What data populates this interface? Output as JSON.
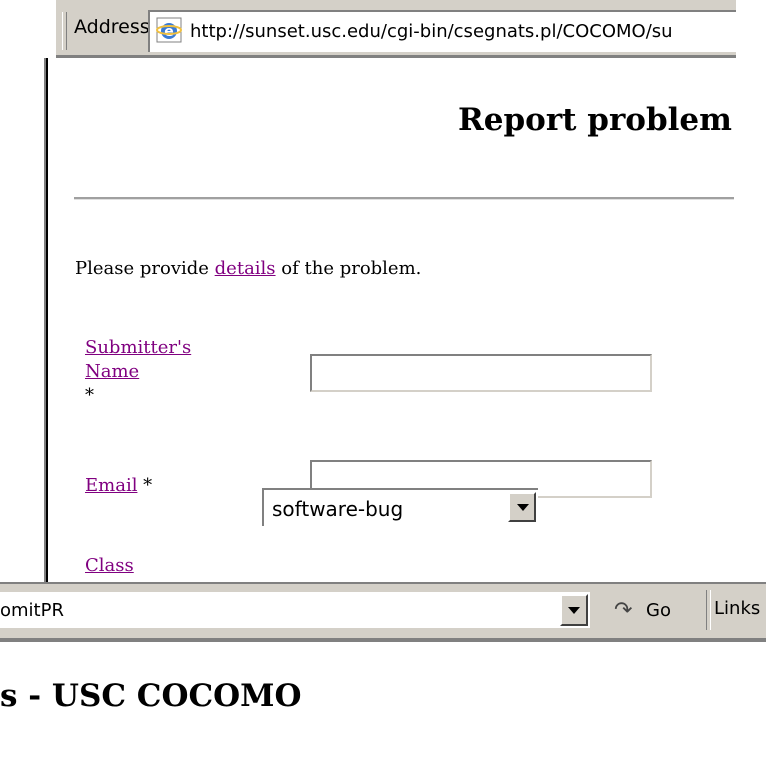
{
  "window_top": {
    "address_label": "Address",
    "url": "http://sunset.usc.edu/cgi-bin/csegnats.pl/COCOMO/su",
    "page_title": "Report problem",
    "intro": {
      "before": "Please provide ",
      "link": "details",
      "after": " of the problem."
    },
    "form": {
      "submitter_label_line1": "Submitter's",
      "submitter_label_line2": "Name",
      "submitter_required": "*",
      "email_label": "Email",
      "email_required": " *",
      "class_label": "Class",
      "class_value": "software-bug"
    }
  },
  "window_bottom": {
    "url": "omitPR",
    "go_label": "Go",
    "links_label": "Links",
    "page_title": "s - USC COCOMO"
  },
  "colors": {
    "link": "#800080",
    "chrome": "#d4d0c8"
  }
}
